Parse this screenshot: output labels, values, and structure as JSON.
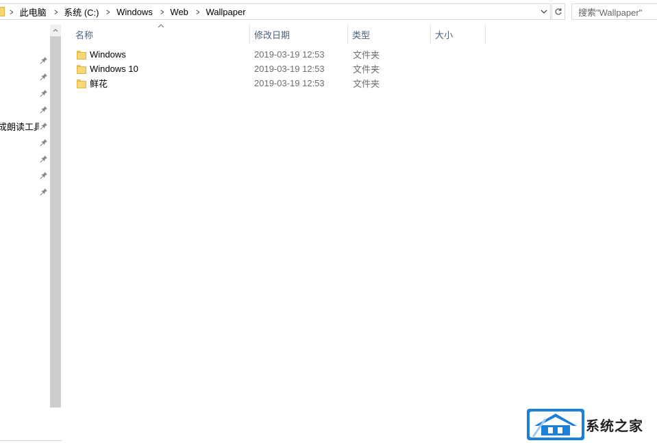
{
  "address_bar": {
    "breadcrumbs": [
      "此电脑",
      "系统 (C:)",
      "Windows",
      "Web",
      "Wallpaper"
    ]
  },
  "search": {
    "placeholder": "搜索\"Wallpaper\""
  },
  "nav_pane": {
    "items": [
      {
        "label": "",
        "pinned": true
      },
      {
        "label": "",
        "pinned": true
      },
      {
        "label": "",
        "pinned": true
      },
      {
        "label": "",
        "pinned": true
      },
      {
        "label": "成朗读工具\\",
        "pinned": true
      },
      {
        "label": "",
        "pinned": true
      },
      {
        "label": "",
        "pinned": true
      },
      {
        "label": "",
        "pinned": true
      },
      {
        "label": "",
        "pinned": true
      }
    ]
  },
  "columns": {
    "name": "名称",
    "date": "修改日期",
    "type": "类型",
    "size": "大小"
  },
  "files": [
    {
      "name": "Windows",
      "date": "2019-03-19 12:53",
      "type": "文件夹",
      "size": ""
    },
    {
      "name": "Windows 10",
      "date": "2019-03-19 12:53",
      "type": "文件夹",
      "size": ""
    },
    {
      "name": "鲜花",
      "date": "2019-03-19 12:53",
      "type": "文件夹",
      "size": ""
    }
  ],
  "watermark": {
    "text": "系统之家"
  },
  "colors": {
    "header_text": "#4c607a",
    "folder_yellow": "#f8d775",
    "scrollbar_thumb": "#cdcdcd",
    "watermark_blue": "#1e7fd8"
  }
}
